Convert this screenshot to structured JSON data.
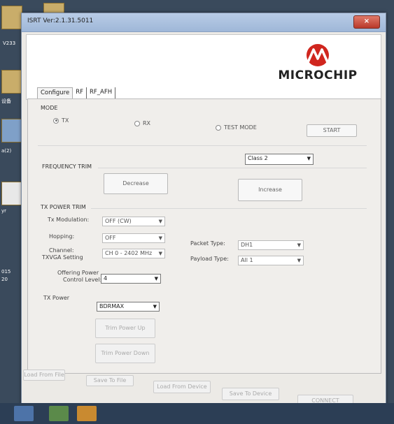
{
  "desktop": {
    "labels": [
      "V233",
      "设备",
      "a(2)",
      "yr",
      "015",
      "20"
    ]
  },
  "window": {
    "title": "ISRT Ver:2.1.31.5011",
    "close_label": "×"
  },
  "brand": {
    "logo_text": "MICROCHIP"
  },
  "tabs": [
    {
      "label": "Configure"
    },
    {
      "label": "RF"
    },
    {
      "label": "RF_AFH"
    }
  ],
  "mode": {
    "label": "MODE",
    "options": [
      {
        "label": "TX",
        "checked": true
      },
      {
        "label": "RX",
        "checked": false
      },
      {
        "label": "TEST MODE",
        "checked": false
      }
    ],
    "start_label": "START"
  },
  "class_select": {
    "value": "Class 2"
  },
  "frequency_trim": {
    "label": "FREQUENCY TRIM",
    "decrease_label": "Decrease",
    "increase_label": "Increase"
  },
  "tx_power_trim": {
    "label": "TX POWER TRIM",
    "tx_modulation_label": "Tx Modulation:",
    "tx_modulation_value": "OFF (CW)",
    "hopping_label": "Hopping:",
    "hopping_value": "OFF",
    "channel_label": "Channel:",
    "channel_value": "CH 0 - 2402 MHz",
    "txvga_label": "TXVGA Setting",
    "packet_type_label": "Packet Type:",
    "packet_type_value": "DH1",
    "payload_type_label": "Payload Type:",
    "payload_type_value": "All 1",
    "offering_power_label_1": "Offering Power",
    "offering_power_label_2": "Control Level:",
    "offering_power_value": "4",
    "tx_power_label": "TX Power",
    "tx_power_value": "BDRMAX",
    "trim_up_label": "Trim Power Up",
    "trim_down_label": "Trim Power Down"
  },
  "footer": {
    "load_file": "Load From File",
    "save_file": "Save To File",
    "load_device": "Load From Device",
    "save_device": "Save To Device",
    "connect": "CONNECT"
  }
}
